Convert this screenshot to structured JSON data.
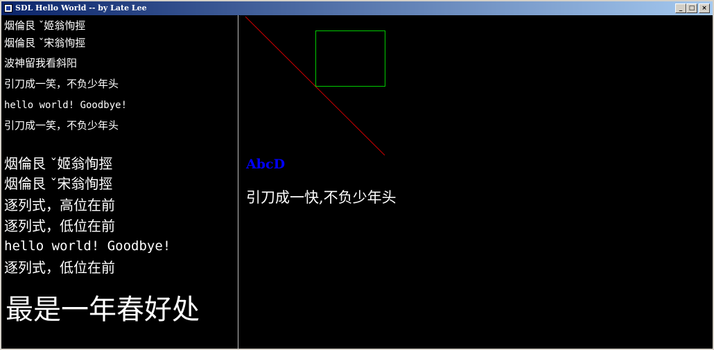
{
  "window": {
    "title": "SDL Hello World -- by Late Lee",
    "buttons": {
      "minimize": "_",
      "maximize": "□",
      "close": "×"
    }
  },
  "left_panel": {
    "small_lines": [
      "烟倫艮 ˇ姬翁恂挳",
      "烟倫艮 ˇ宋翁恂挳",
      "波神留我看斜阳",
      "引刀成一笑，不负少年头",
      "hello world! Goodbye!",
      "引刀成一笑，不负少年头"
    ],
    "medium_lines": [
      "烟倫艮 ˇ姬翁恂挳",
      "烟倫艮 ˇ宋翁恂挳",
      "逐列式，高位在前",
      "逐列式，低位在前",
      "hello world! Goodbye!",
      "逐列式，低位在前"
    ],
    "large_line": "最是一年春好处"
  },
  "right_panel": {
    "blue_text": "AbcD",
    "white_text": "引刀成一快,不负少年头"
  },
  "colors": {
    "line": "#cc0000",
    "rect": "#00cc00",
    "blue_text": "#0000ff",
    "text": "#ffffff"
  }
}
